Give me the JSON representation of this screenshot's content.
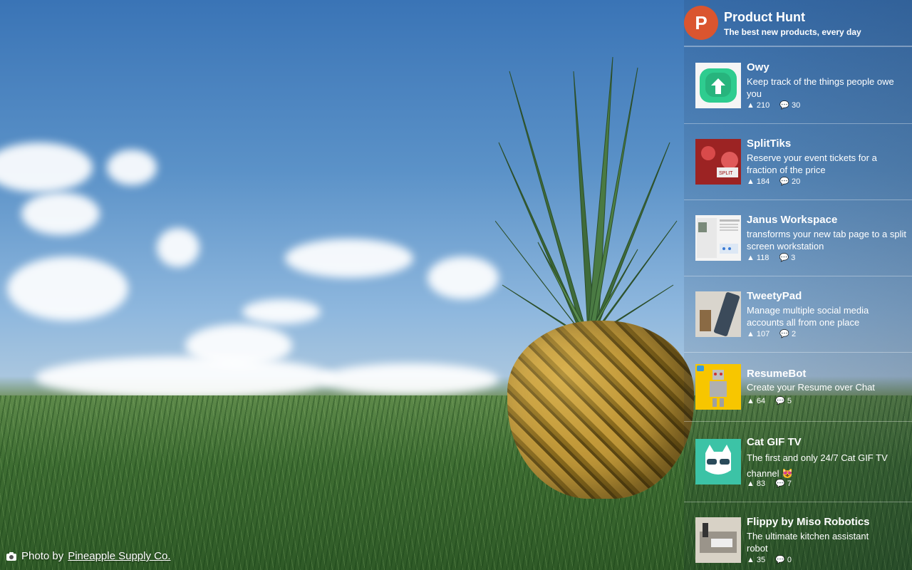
{
  "header": {
    "logo_letter": "P",
    "title": "Product Hunt",
    "subtitle": "The best new products, every day"
  },
  "products": [
    {
      "name": "Owy",
      "tagline": "Keep track of the things people owe you",
      "votes": "210",
      "comments": "30"
    },
    {
      "name": "SplitTiks",
      "tagline": "Reserve your event tickets for a fraction of the price",
      "votes": "184",
      "comments": "20"
    },
    {
      "name": "Janus Workspace",
      "tagline": "transforms your new tab page to a split screen workstation",
      "votes": "118",
      "comments": "3"
    },
    {
      "name": "TweetyPad",
      "tagline": "Manage multiple social media accounts all from one place",
      "votes": "107",
      "comments": "2"
    },
    {
      "name": "ResumeBot",
      "tagline": "Create your Resume over Chat",
      "votes": "64",
      "comments": "5"
    },
    {
      "name": "Cat GIF TV",
      "tagline": "The first and only 24/7 Cat GIF TV channel 😻",
      "votes": "83",
      "comments": "7"
    },
    {
      "name": "Flippy by Miso Robotics",
      "tagline": "The ultimate kitchen assistant robot",
      "votes": "35",
      "comments": "0"
    }
  ],
  "credit": {
    "prefix": "Photo by",
    "author": "Pineapple Supply Co."
  },
  "colors": {
    "brand": "#da552f"
  },
  "icons": {
    "upvote": "upvote-triangle-icon",
    "comment": "comment-bubble-icon",
    "camera": "camera-icon"
  }
}
